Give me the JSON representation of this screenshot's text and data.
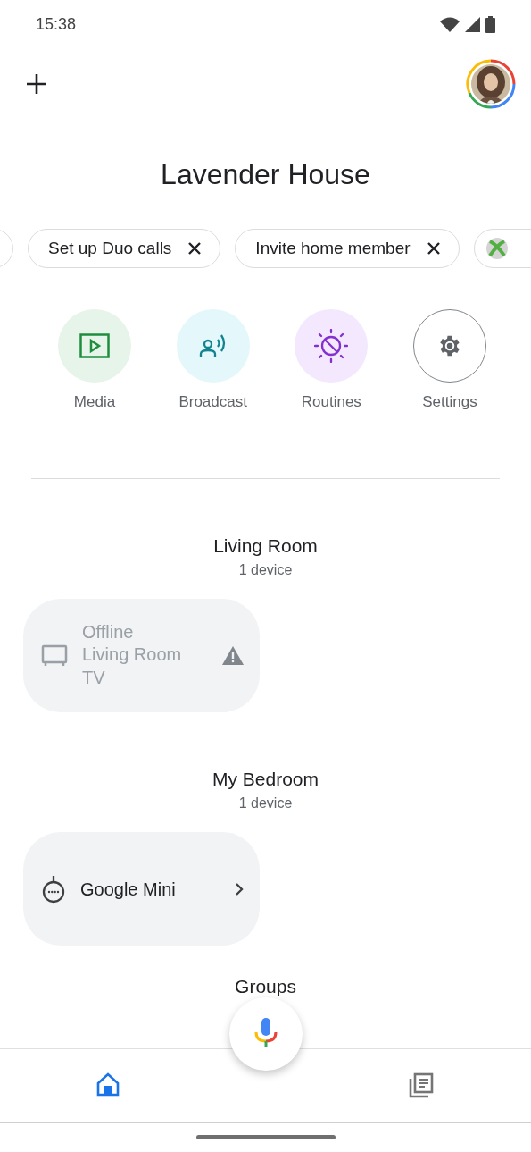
{
  "status_bar": {
    "time": "15:38"
  },
  "home": {
    "title": "Lavender House"
  },
  "chips": [
    {
      "kind": "partial"
    },
    {
      "kind": "text",
      "label": "Set up Duo calls"
    },
    {
      "kind": "text",
      "label": "Invite home member"
    },
    {
      "kind": "xbox"
    }
  ],
  "actions": [
    {
      "kind": "media",
      "label": "Media"
    },
    {
      "kind": "broadcast",
      "label": "Broadcast"
    },
    {
      "kind": "routines",
      "label": "Routines"
    },
    {
      "kind": "settings",
      "label": "Settings"
    }
  ],
  "rooms": [
    {
      "name": "Living Room",
      "count": "1 device",
      "devices": [
        {
          "kind": "tv",
          "status": "Offline",
          "name": "Living Room TV",
          "offline": true
        }
      ]
    },
    {
      "name": "My Bedroom",
      "count": "1 device",
      "devices": [
        {
          "kind": "speaker",
          "name": "Google Mini",
          "offline": false
        }
      ]
    }
  ],
  "groups": {
    "title": "Groups"
  },
  "nav": [
    {
      "kind": "home",
      "selected": true
    },
    {
      "kind": "feed",
      "selected": false
    }
  ]
}
